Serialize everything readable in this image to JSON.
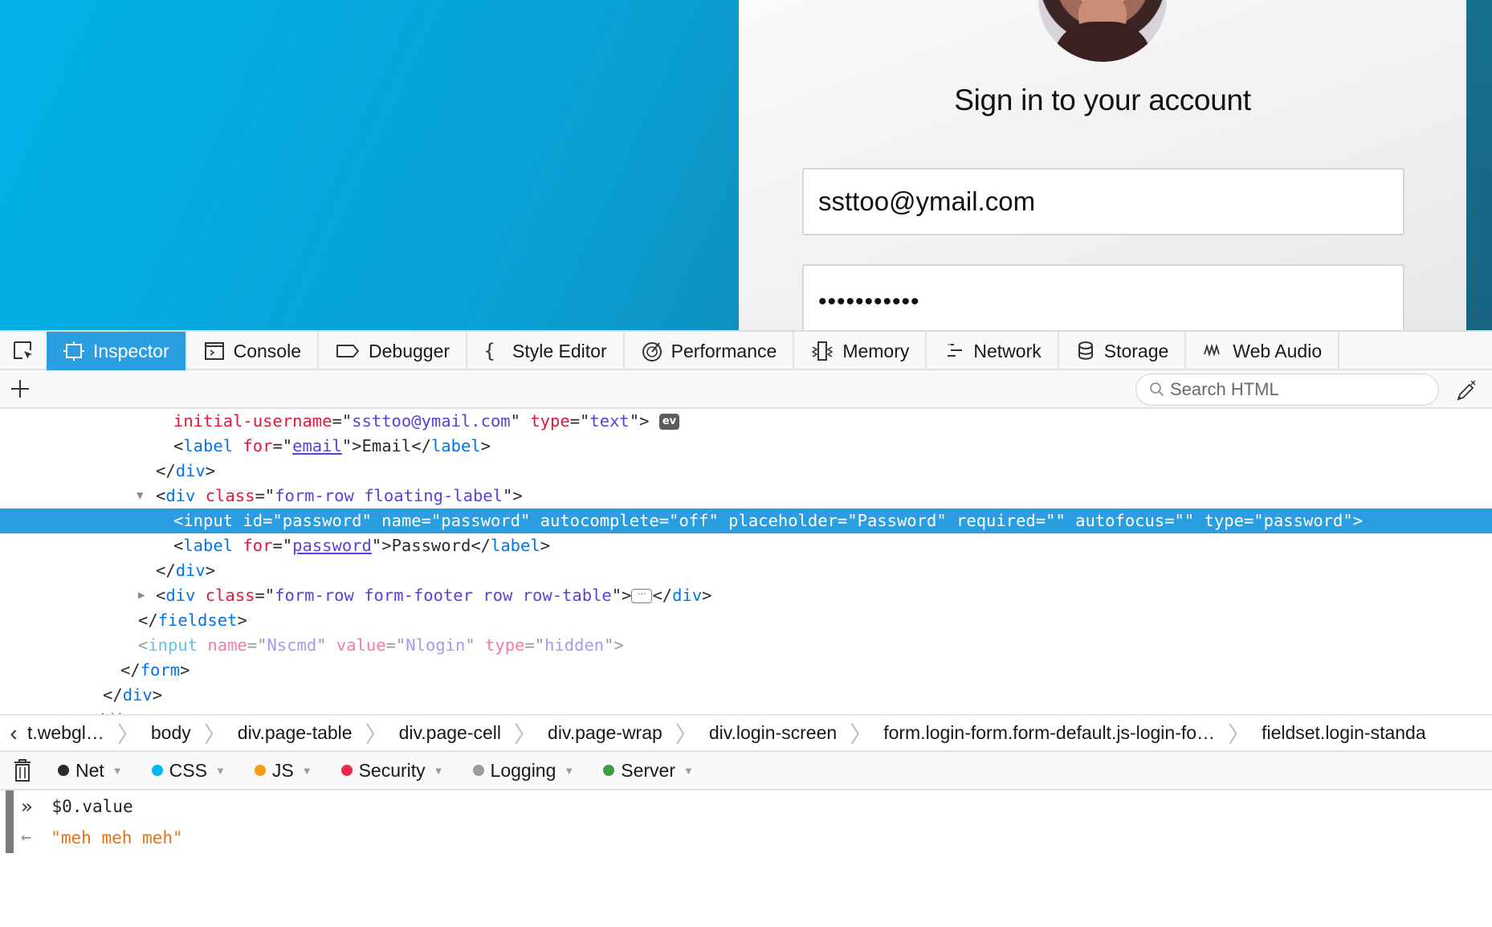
{
  "page": {
    "signin_title": "Sign in to your account",
    "email_value": "ssttoo@ymail.com",
    "password_value": "•••••••••••"
  },
  "devtools": {
    "tabs": [
      {
        "label": "Inspector",
        "icon": "inspector-icon",
        "active": true
      },
      {
        "label": "Console",
        "icon": "console-icon"
      },
      {
        "label": "Debugger",
        "icon": "debugger-icon"
      },
      {
        "label": "Style Editor",
        "icon": "style-editor-icon"
      },
      {
        "label": "Performance",
        "icon": "performance-icon"
      },
      {
        "label": "Memory",
        "icon": "memory-icon"
      },
      {
        "label": "Network",
        "icon": "network-icon"
      },
      {
        "label": "Storage",
        "icon": "storage-icon"
      },
      {
        "label": "Web Audio",
        "icon": "web-audio-icon"
      }
    ],
    "search_placeholder": "Search HTML",
    "markup": {
      "r0": {
        "a1": "initial-username",
        "v1": "ssttoo@ymail.com",
        "a2": "type",
        "v2": "text",
        "badge": "ev"
      },
      "r1": {
        "tag": "label",
        "attr": "for",
        "val": "email",
        "text": "Email",
        "close": "label"
      },
      "r2": {
        "close": "div"
      },
      "r3": {
        "tag": "div",
        "attr": "class",
        "val": "form-row floating-label"
      },
      "r4": {
        "text": "<input id=\"password\" name=\"password\" autocomplete=\"off\" placeholder=\"Password\" required=\"\" autofocus=\"\" type=\"password\">"
      },
      "r5": {
        "tag": "label",
        "attr": "for",
        "val": "password",
        "text": "Password",
        "close": "label"
      },
      "r6": {
        "close": "div"
      },
      "r7": {
        "tag": "div",
        "attr": "class",
        "val": "form-row form-footer row row-table",
        "close": "div"
      },
      "r8": {
        "close": "fieldset"
      },
      "r9": {
        "tag": "input",
        "a1": "name",
        "v1": "Nscmd",
        "a2": "value",
        "v2": "Nlogin",
        "a3": "type",
        "v3": "hidden"
      },
      "r10": {
        "close": "form"
      },
      "r11": {
        "close": "div"
      },
      "r12": {
        "close": "div"
      }
    },
    "breadcrumbs": [
      "t.webgl…",
      "body",
      "div.page-table",
      "div.page-cell",
      "div.page-wrap",
      "div.login-screen",
      "form.login-form.form-default.js-login-fo…",
      "fieldset.login-standa"
    ],
    "console_filters": [
      {
        "label": "Net",
        "color": "#2a2a2e",
        "active": true
      },
      {
        "label": "CSS",
        "color": "#00b6f0",
        "active": true
      },
      {
        "label": "JS",
        "color": "#f39c12",
        "active": true
      },
      {
        "label": "Security",
        "color": "#ed2655",
        "active": true
      },
      {
        "label": "Logging",
        "color": "#9b9b9b",
        "active": false
      },
      {
        "label": "Server",
        "color": "#3b9b49",
        "active": true
      }
    ],
    "console": {
      "input": "$0.value",
      "result": "\"meh meh meh\""
    }
  }
}
